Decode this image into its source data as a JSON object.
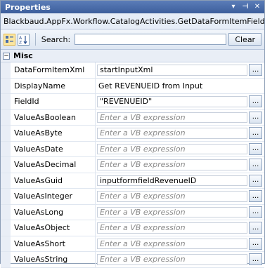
{
  "window": {
    "title": "Properties"
  },
  "object_header": "Blackbaud.AppFx.Workflow.CatalogActivities.GetDataFormItemFieldValue",
  "toolbar": {
    "search_label": "Search:",
    "search_value": "",
    "clear_label": "Clear"
  },
  "category": {
    "name": "Misc",
    "toggle": "−"
  },
  "properties": [
    {
      "name": "DataFormItemXml",
      "value": "startInputXml",
      "has_button": true,
      "placeholder": false
    },
    {
      "name": "DisplayName",
      "value": "Get REVENUEID from Input",
      "has_button": false,
      "placeholder": false
    },
    {
      "name": "FieldId",
      "value": "\"REVENUEID\"",
      "has_button": true,
      "placeholder": false
    },
    {
      "name": "ValueAsBoolean",
      "value": "Enter a VB expression",
      "has_button": true,
      "placeholder": true
    },
    {
      "name": "ValueAsByte",
      "value": "Enter a VB expression",
      "has_button": true,
      "placeholder": true
    },
    {
      "name": "ValueAsDate",
      "value": "Enter a VB expression",
      "has_button": true,
      "placeholder": true
    },
    {
      "name": "ValueAsDecimal",
      "value": "Enter a VB expression",
      "has_button": true,
      "placeholder": true
    },
    {
      "name": "ValueAsGuid",
      "value": "inputformfieldRevenueID",
      "has_button": true,
      "placeholder": false
    },
    {
      "name": "ValueAsInteger",
      "value": "Enter a VB expression",
      "has_button": true,
      "placeholder": true
    },
    {
      "name": "ValueAsLong",
      "value": "Enter a VB expression",
      "has_button": true,
      "placeholder": true
    },
    {
      "name": "ValueAsObject",
      "value": "Enter a VB expression",
      "has_button": true,
      "placeholder": true
    },
    {
      "name": "ValueAsShort",
      "value": "Enter a VB expression",
      "has_button": true,
      "placeholder": true
    },
    {
      "name": "ValueAsString",
      "value": "Enter a VB expression",
      "has_button": true,
      "placeholder": true
    }
  ],
  "button_label": "...",
  "icons": {
    "title_dropdown": "▾",
    "title_pin": "⊣",
    "title_close": "✕",
    "categorized": "categorized-icon",
    "alphabetical": "alphabetical-icon"
  }
}
